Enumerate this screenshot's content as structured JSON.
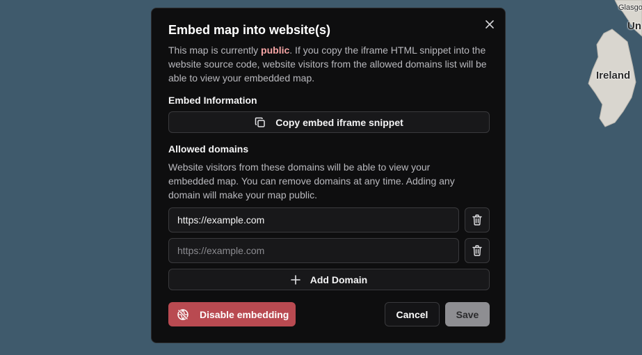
{
  "map": {
    "labels": {
      "ireland": "Ireland",
      "glasgow": "Glasgo",
      "united_kingdom_partial": "Un"
    }
  },
  "modal": {
    "title": "Embed map into website(s)",
    "description": {
      "prefix": "This map is currently ",
      "status_word": "public",
      "suffix": ". If you copy the iframe HTML snippet into the website source code, website visitors from the allowed domains list will be able to view your embedded map."
    },
    "embed_section": {
      "label": "Embed Information",
      "copy_button_label": "Copy embed iframe snippet"
    },
    "domains_section": {
      "label": "Allowed domains",
      "description": "Website visitors from these domains will be able to view your embedded map. You can remove domains at any time. Adding any domain will make your map public.",
      "domains": [
        {
          "value": "https://example.com",
          "placeholder": "https://example.com"
        },
        {
          "value": "",
          "placeholder": "https://example.com"
        }
      ],
      "add_button_label": "Add Domain"
    },
    "footer": {
      "disable_label": "Disable embedding",
      "cancel_label": "Cancel",
      "save_label": "Save"
    },
    "icons": {
      "close": "close-icon",
      "copy": "copy-icon",
      "trash": "trash-icon",
      "plus": "plus-icon",
      "globe_off": "globe-off-icon"
    }
  },
  "colors": {
    "map_water": "#3f5a6c",
    "modal_bg": "#0e0e0f",
    "public_highlight": "#f6a5a5",
    "danger": "#b94a51",
    "save_disabled": "#8e8e92"
  }
}
